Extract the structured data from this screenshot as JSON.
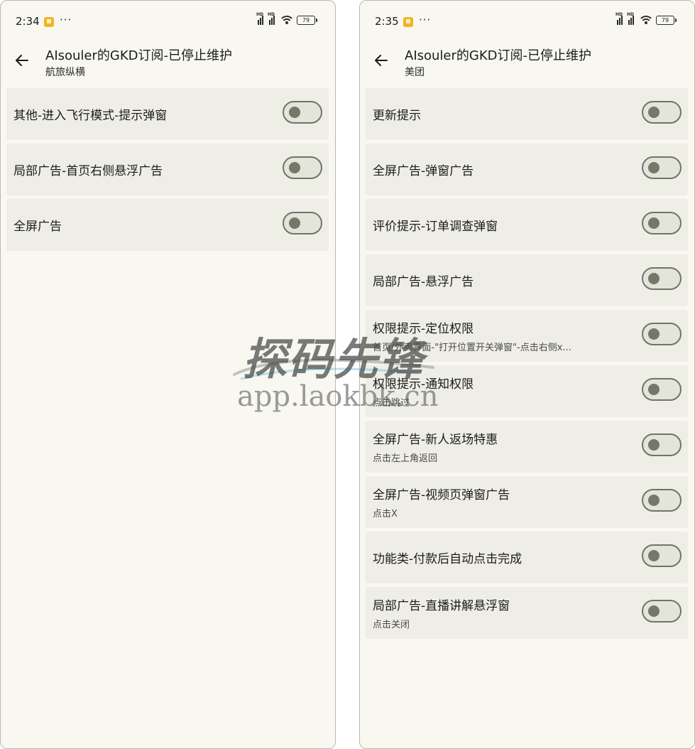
{
  "left": {
    "status": {
      "time": "2:34",
      "dots": "···",
      "battery": "79"
    },
    "header": {
      "title": "AIsouler的GKD订阅-已停止维护",
      "subtitle": "航旅纵横"
    },
    "rules": [
      {
        "label": "其他-进入飞行模式-提示弹窗",
        "desc": ""
      },
      {
        "label": "局部广告-首页右侧悬浮广告",
        "desc": ""
      },
      {
        "label": "全屏广告",
        "desc": ""
      }
    ]
  },
  "right": {
    "status": {
      "time": "2:35",
      "dots": "···",
      "battery": "79"
    },
    "header": {
      "title": "AIsouler的GKD订阅-已停止维护",
      "subtitle": "美团"
    },
    "rules": [
      {
        "label": "更新提示",
        "desc": ""
      },
      {
        "label": "全屏广告-弹窗广告",
        "desc": ""
      },
      {
        "label": "评价提示-订单调查弹窗",
        "desc": ""
      },
      {
        "label": "局部广告-悬浮广告",
        "desc": ""
      },
      {
        "label": "权限提示-定位权限",
        "desc": "首页/外卖界面-\"打开位置开关弹窗\"-点击右侧x..."
      },
      {
        "label": "权限提示-通知权限",
        "desc": "点击跳过"
      },
      {
        "label": "全屏广告-新人返场特惠",
        "desc": "点击左上角返回"
      },
      {
        "label": "全屏广告-视频页弹窗广告",
        "desc": "点击X"
      },
      {
        "label": "功能类-付款后自动点击完成",
        "desc": ""
      },
      {
        "label": "局部广告-直播讲解悬浮窗",
        "desc": "点击关闭"
      }
    ]
  },
  "watermark": {
    "main": "探码先锋",
    "sub": "app.laokbk.cn"
  },
  "colors": {
    "background": "#f8f8f0",
    "card": "#eeeee6",
    "toggle_off": "#737868"
  }
}
